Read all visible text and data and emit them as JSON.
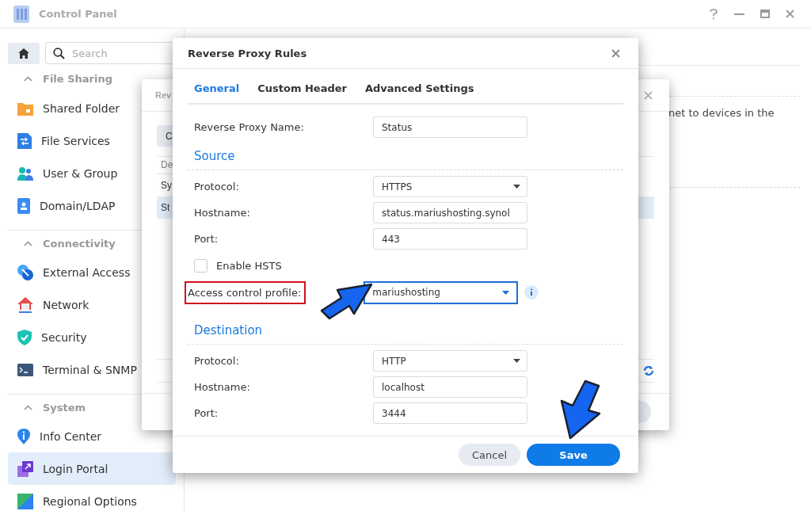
{
  "window": {
    "title": "Control Panel"
  },
  "search": {
    "placeholder": "Search"
  },
  "sidebar": {
    "sections": [
      {
        "title": "File Sharing",
        "expanded": true,
        "items": [
          {
            "label": "Shared Folder",
            "selected": false
          },
          {
            "label": "File Services",
            "selected": false
          },
          {
            "label": "User & Group",
            "selected": false
          },
          {
            "label": "Domain/LDAP",
            "selected": false
          }
        ]
      },
      {
        "title": "Connectivity",
        "expanded": true,
        "items": [
          {
            "label": "External Access",
            "selected": false
          },
          {
            "label": "Network",
            "selected": false
          },
          {
            "label": "Security",
            "selected": false
          },
          {
            "label": "Terminal & SNMP",
            "selected": false
          }
        ]
      },
      {
        "title": "System",
        "expanded": true,
        "items": [
          {
            "label": "Info Center",
            "selected": false
          },
          {
            "label": "Login Portal",
            "selected": true
          },
          {
            "label": "Regional Options",
            "selected": false
          }
        ]
      }
    ]
  },
  "content": {
    "text": "net to devices in the"
  },
  "back_dialog": {
    "title": "Rev",
    "button": "C",
    "header": "De",
    "rows": [
      {
        "label": "Sy",
        "selected": false
      },
      {
        "label": "St",
        "selected": true
      }
    ]
  },
  "dialog": {
    "title": "Reverse Proxy Rules",
    "tabs": [
      {
        "label": "General",
        "selected": true
      },
      {
        "label": "Custom Header",
        "selected": false
      },
      {
        "label": "Advanced Settings",
        "selected": false
      }
    ],
    "name_field": {
      "label": "Reverse Proxy Name:",
      "value": "Status"
    },
    "sections": [
      {
        "title": "Source",
        "fields": [
          {
            "kind": "select",
            "label": "Protocol:",
            "value": "HTTPS",
            "focused": false,
            "highlighted": false,
            "info": false
          },
          {
            "kind": "text",
            "label": "Hostname:",
            "value": "status.mariushosting.synol",
            "focused": false,
            "highlighted": false,
            "info": false
          },
          {
            "kind": "text",
            "label": "Port:",
            "value": "443",
            "focused": false,
            "highlighted": false,
            "info": false
          },
          {
            "kind": "checkbox",
            "label": "Enable HSTS",
            "checked": false
          },
          {
            "kind": "select",
            "label": "Access control profile:",
            "value": "mariushosting",
            "focused": true,
            "highlighted": true,
            "info": true
          }
        ]
      },
      {
        "title": "Destination",
        "fields": [
          {
            "kind": "select",
            "label": "Protocol:",
            "value": "HTTP",
            "focused": false,
            "highlighted": false,
            "info": false
          },
          {
            "kind": "text",
            "label": "Hostname:",
            "value": "localhost",
            "focused": false,
            "highlighted": false,
            "info": false
          },
          {
            "kind": "text",
            "label": "Port:",
            "value": "3444",
            "focused": false,
            "highlighted": false,
            "info": false
          }
        ]
      }
    ],
    "buttons": [
      {
        "label": "Cancel",
        "kind": "secondary"
      },
      {
        "label": "Save",
        "kind": "primary"
      }
    ]
  }
}
